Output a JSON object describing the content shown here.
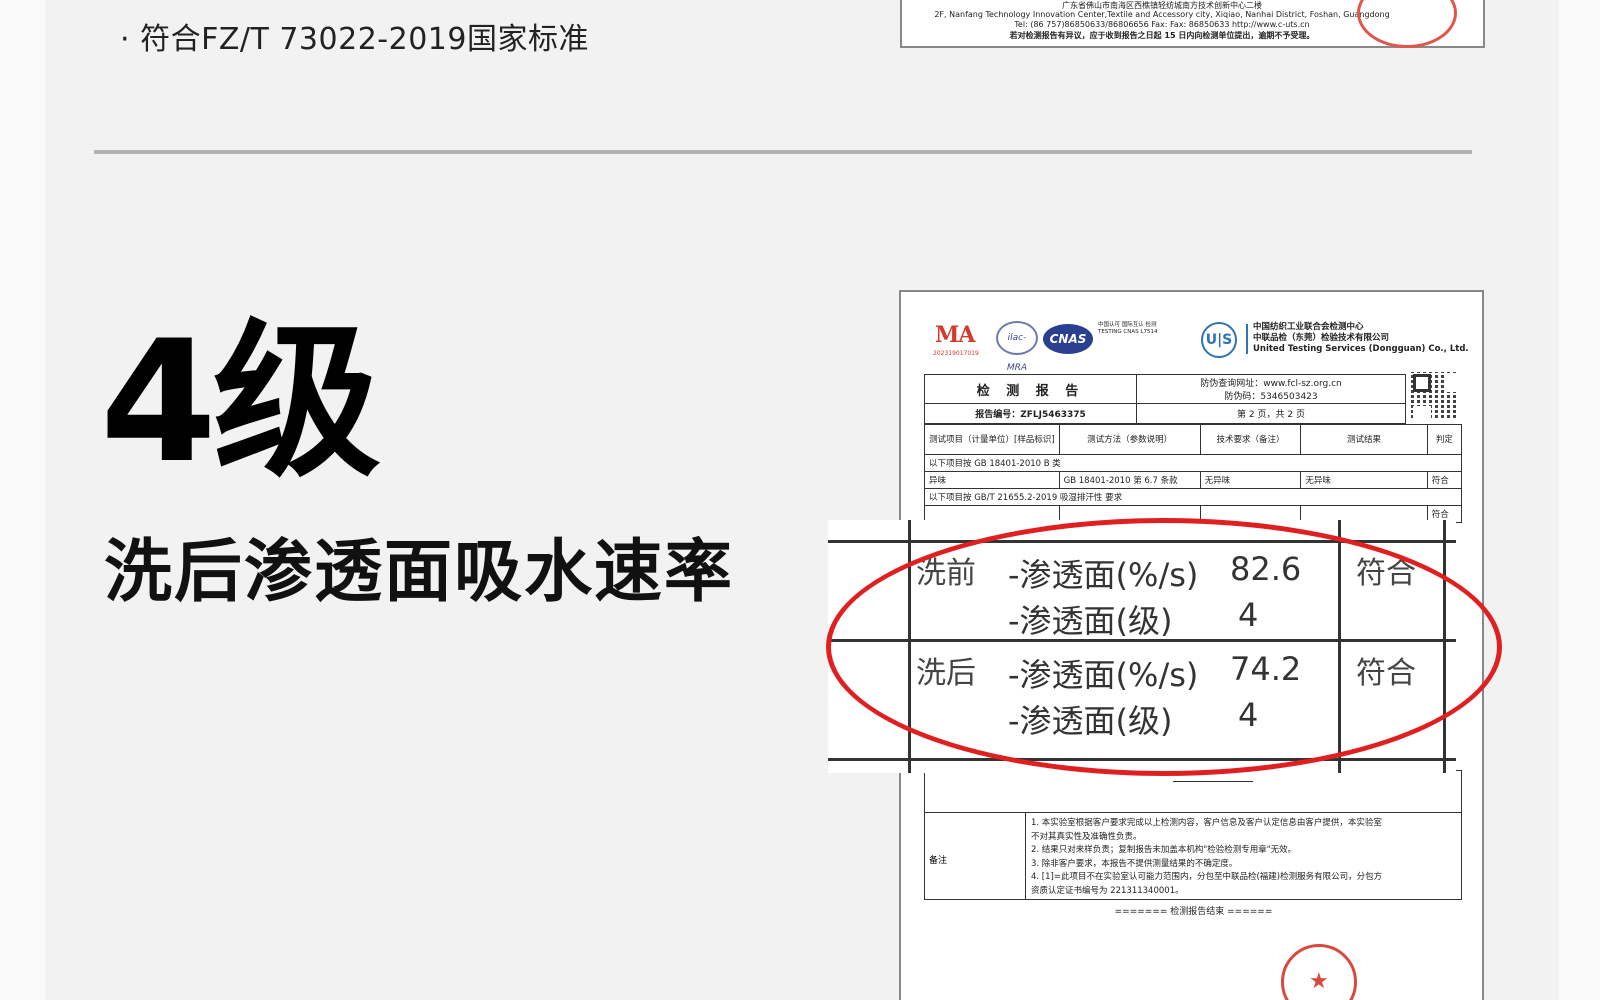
{
  "intro": {
    "bullet_text": "· 符合FZ/T 73022-2019国家标准"
  },
  "headline": {
    "grade": "4级",
    "subtitle": "洗后渗透面吸水速率"
  },
  "report_top": {
    "line1": "广东省佛山市南海区西樵镇轻纺城南方技术创新中心二楼",
    "line2": "2F, Nanfang Technology Innovation Center,Textile and Accessory city, Xiqiao, Nanhai District, Foshan, Guangdong",
    "line3": "Tel: (86 757)86850633/86806656    Fax: Fax: 86850633 http://www.c-uts.cn",
    "line4": "若对检测报告有异议，应于收到报告之日起 15 日内向检测单位提出，逾期不予受理。"
  },
  "report": {
    "logos": {
      "ma": "MA",
      "ma_number": "202319017019",
      "ilac": "ilac-MRA",
      "cnas": "CNAS",
      "cnas_text": "中国认可 国际互认 检测 TESTING CNAS L7514",
      "uts": "U|S",
      "uts_line1": "中国纺织工业联合会检测中心",
      "uts_line2": "中联品检（东莞）检验技术有限公司",
      "uts_line3": "United Testing Services (Dongguan) Co., Ltd."
    },
    "header": {
      "title": "检 测 报 告",
      "query_site": "防伪查询网址：www.fcl-sz.org.cn",
      "anti_fake_code": "防伪码：5346503423",
      "report_no": "报告编号：ZFLJ5463375",
      "page": "第 2 页，共 2 页"
    },
    "columns": [
      "测试项目（计量单位）[样品标识]",
      "测试方法（参数说明）",
      "技术要求（备注）",
      "测试结果",
      "判定"
    ],
    "rows": [
      {
        "item": "以下项目按 GB 18401-2010 B 类",
        "method": "",
        "req": "",
        "result": "",
        "verdict": ""
      },
      {
        "item": "异味",
        "method": "GB 18401-2010 第 6.7 条款",
        "req": "无异味",
        "result": "无异味",
        "verdict": "符合"
      },
      {
        "item": "以下项目按 GB/T 21655.2-2019 吸湿排汗性 要求",
        "method": "",
        "req": "",
        "result": "",
        "verdict": ""
      },
      {
        "item": "",
        "method": "",
        "req": "",
        "result": "",
        "verdict": "符合"
      }
    ],
    "notes_label": "备注",
    "notes": [
      "1.    本实验室根据客户要求完成以上检测内容，客户信息及客户认定信息由客户提供，本实验室",
      "不对其真实性及准确性负责。",
      "2.    结果只对来样负责；复制报告未加盖本机构\"检验检测专用章\"无效。",
      "3.    除非客户要求，本报告不提供测量结果的不确定度。",
      "4.    [1]=此项目不在实验室认可能力范围内，分包至中联品检(福建)检测服务有限公司，分包方",
      "资质认定证书编号为 221311340001。"
    ],
    "end_text": "======= 检测报告结束 ======"
  },
  "zoom": {
    "before_label": "洗前",
    "before_rate_label": "-渗透面(%/s)",
    "before_rate_value": "82.6",
    "before_grade_label": "-渗透面(级)",
    "before_grade_value": "4",
    "before_verdict": "符合",
    "after_label": "洗后",
    "after_rate_label": "-渗透面(%/s)",
    "after_rate_value": "74.2",
    "after_grade_label": "-渗透面(级)",
    "after_grade_value": "4",
    "after_verdict": "符合"
  },
  "colors": {
    "highlight": "#e02020",
    "stamp": "#d94a3e",
    "divider": "#b3b3b3"
  }
}
